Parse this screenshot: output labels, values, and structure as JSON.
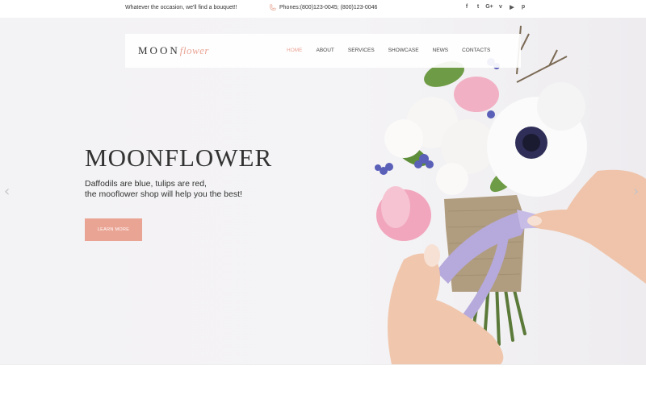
{
  "topbar": {
    "tagline": "Whatever the occasion, we'll find a bouquet!!",
    "phones": "Phones:(800)123-0045; (800)123-0046",
    "socials": [
      {
        "icon": "facebook-icon",
        "glyph": "f"
      },
      {
        "icon": "twitter-icon",
        "glyph": "t"
      },
      {
        "icon": "google-plus-icon",
        "glyph": "G+"
      },
      {
        "icon": "vimeo-icon",
        "glyph": "v"
      },
      {
        "icon": "youtube-icon",
        "glyph": "▶"
      },
      {
        "icon": "pinterest-icon",
        "glyph": "p"
      }
    ]
  },
  "nav": {
    "logo_a": "MOON",
    "logo_b": "flower",
    "items": [
      "HOME",
      "ABOUT",
      "SERVICES",
      "SHOWCASE",
      "NEWS",
      "CONTACTS"
    ],
    "active": "HOME"
  },
  "hero": {
    "title": "MOONFLOWER",
    "line1": "Daffodils are blue, tulips are red,",
    "line2": "the mooflower shop will help you the best!",
    "button": "LEARN MORE",
    "prev": "‹",
    "next": "›"
  },
  "colors": {
    "accent": "#eaa494",
    "text": "#333333",
    "background": "#f3f2f4"
  }
}
